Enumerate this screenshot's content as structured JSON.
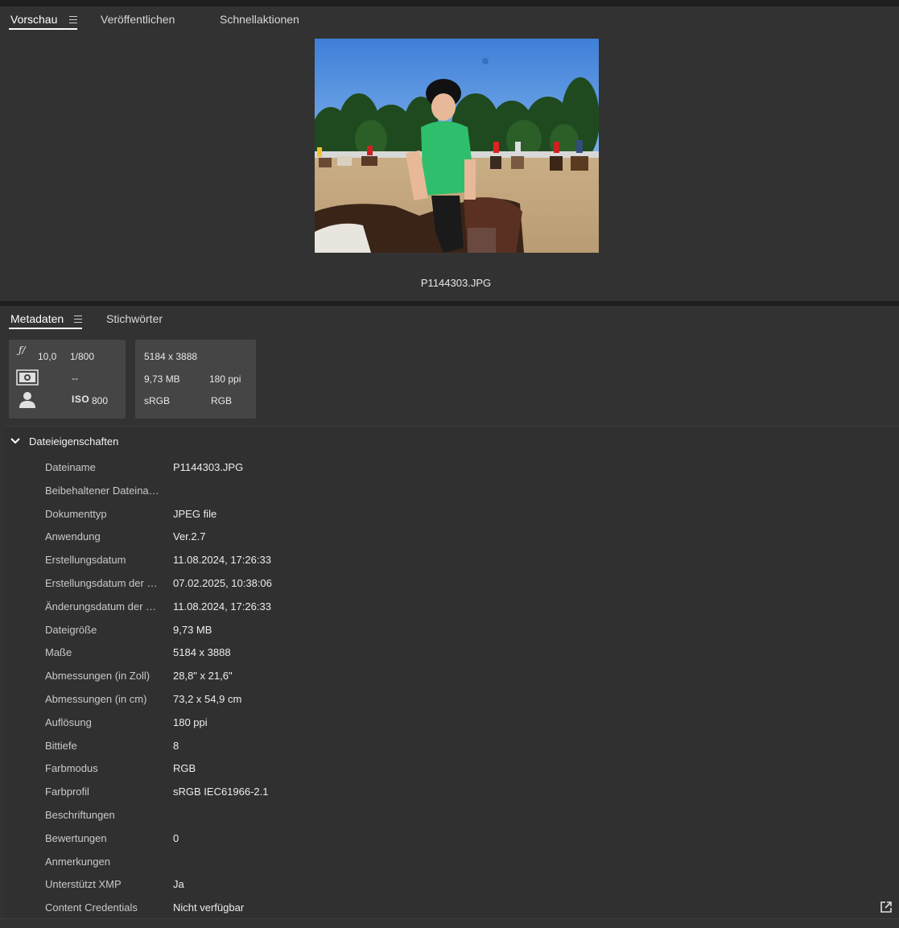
{
  "preview_tabs": [
    {
      "label": "Vorschau",
      "active": true
    },
    {
      "label": "Veröffentlichen",
      "active": false
    },
    {
      "label": "Schnellaktionen",
      "active": false
    }
  ],
  "preview": {
    "file_name": "P1144303.JPG",
    "image_alt": "Foto: Jugendliche mit Reithelm und grünem T-Shirt auf einem Pferd, im Hintergrund Reiter auf einem Sandplatz"
  },
  "meta_tabs": [
    {
      "label": "Metadaten",
      "active": true
    },
    {
      "label": "Stichwörter",
      "active": false
    }
  ],
  "camera_card": {
    "aperture": "10,0",
    "shutter": "1/800",
    "metering": "--",
    "iso_label": "ISO",
    "iso_value": "800"
  },
  "file_card": {
    "dimensions": "5184 x 3888",
    "size": "9,73 MB",
    "resolution": "180 ppi",
    "profile": "sRGB",
    "color_mode": "RGB"
  },
  "section": {
    "title": "Dateieigenschaften",
    "rows": [
      {
        "key": "Dateiname",
        "value": "P1144303.JPG"
      },
      {
        "key": "Beibehaltener Dateiname",
        "value": ""
      },
      {
        "key": "Dokumenttyp",
        "value": "JPEG file"
      },
      {
        "key": "Anwendung",
        "value": "Ver.2.7"
      },
      {
        "key": "Erstellungsdatum",
        "value": "11.08.2024, 17:26:33"
      },
      {
        "key": "Erstellungsdatum der Datei",
        "value": "07.02.2025, 10:38:06"
      },
      {
        "key": "Änderungsdatum der Datei",
        "value": "11.08.2024, 17:26:33"
      },
      {
        "key": "Dateigröße",
        "value": "9,73 MB"
      },
      {
        "key": "Maße",
        "value": "5184 x 3888"
      },
      {
        "key": "Abmessungen (in Zoll)",
        "value": "28,8\" x 21,6\""
      },
      {
        "key": "Abmessungen (in cm)",
        "value": "73,2  x 54,9 cm"
      },
      {
        "key": "Auflösung",
        "value": "180 ppi"
      },
      {
        "key": "Bittiefe",
        "value": "8"
      },
      {
        "key": "Farbmodus",
        "value": "RGB"
      },
      {
        "key": "Farbprofil",
        "value": "sRGB IEC61966-2.1"
      },
      {
        "key": "Beschriftungen",
        "value": ""
      },
      {
        "key": "Bewertungen",
        "value": "0"
      },
      {
        "key": "Anmerkungen",
        "value": ""
      },
      {
        "key": "Unterstützt XMP",
        "value": "Ja"
      },
      {
        "key": "Content Credentials",
        "value": "Nicht verfügbar"
      }
    ]
  },
  "colors": {
    "panel_bg": "#323232",
    "divider": "#1e1e1e",
    "card_bg": "#454545",
    "text": "#e4e4e4"
  },
  "icons": {
    "menu": "hamburger-menu-icon",
    "aperture": "f-stop-icon",
    "metering": "metering-mode-icon",
    "exposure": "person-exposure-icon",
    "collapse": "chevron-down-icon",
    "external": "open-external-icon"
  }
}
